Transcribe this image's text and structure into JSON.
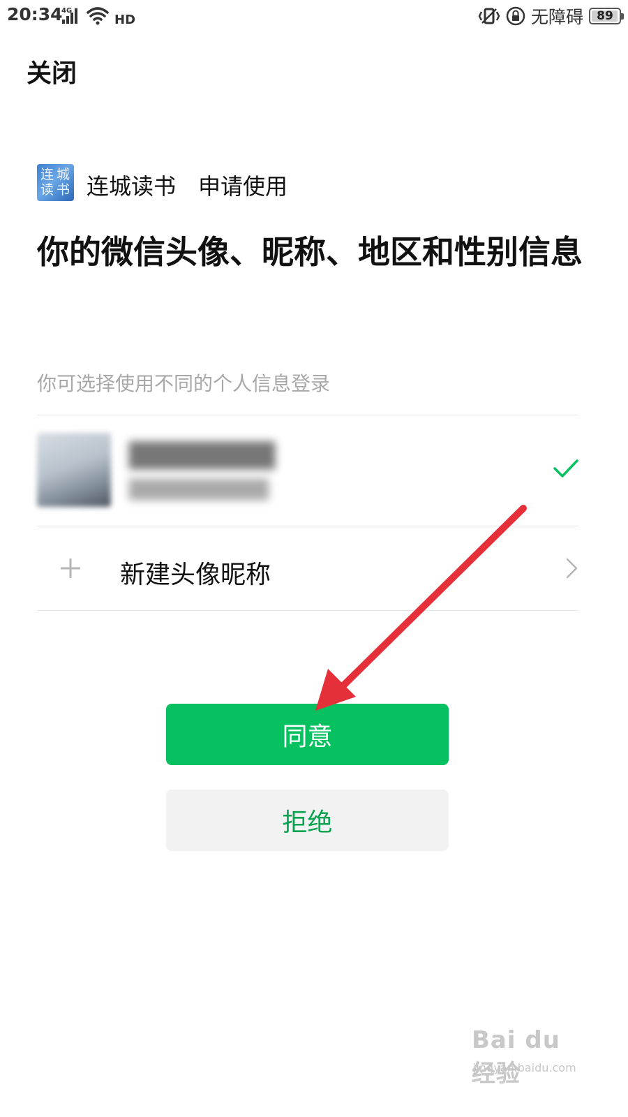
{
  "status_bar": {
    "time": "20:34",
    "network": "4G",
    "hd": "HD",
    "accessibility_label": "无障碍",
    "battery": "89"
  },
  "header": {
    "close_label": "关闭"
  },
  "app": {
    "logo_text": [
      "连",
      "城",
      "读",
      "书"
    ],
    "name": "连城读书",
    "request_label": "申请使用"
  },
  "headline": "你的微信头像、昵称、地区和性别信息",
  "hint": "你可选择使用不同的个人信息登录",
  "account": {
    "selected": true
  },
  "new_profile": {
    "label": "新建头像昵称"
  },
  "buttons": {
    "agree": "同意",
    "reject": "拒绝"
  },
  "watermark": {
    "logo": "Bai du 经验",
    "url": "jingyan.baidu.com"
  },
  "colors": {
    "primary_green": "#07c160",
    "annotation_red": "#e5303a"
  },
  "icons": [
    "signal-icon",
    "wifi-icon",
    "vibrate-icon",
    "lock-rotation-icon",
    "check-icon",
    "plus-icon",
    "chevron-right-icon"
  ]
}
